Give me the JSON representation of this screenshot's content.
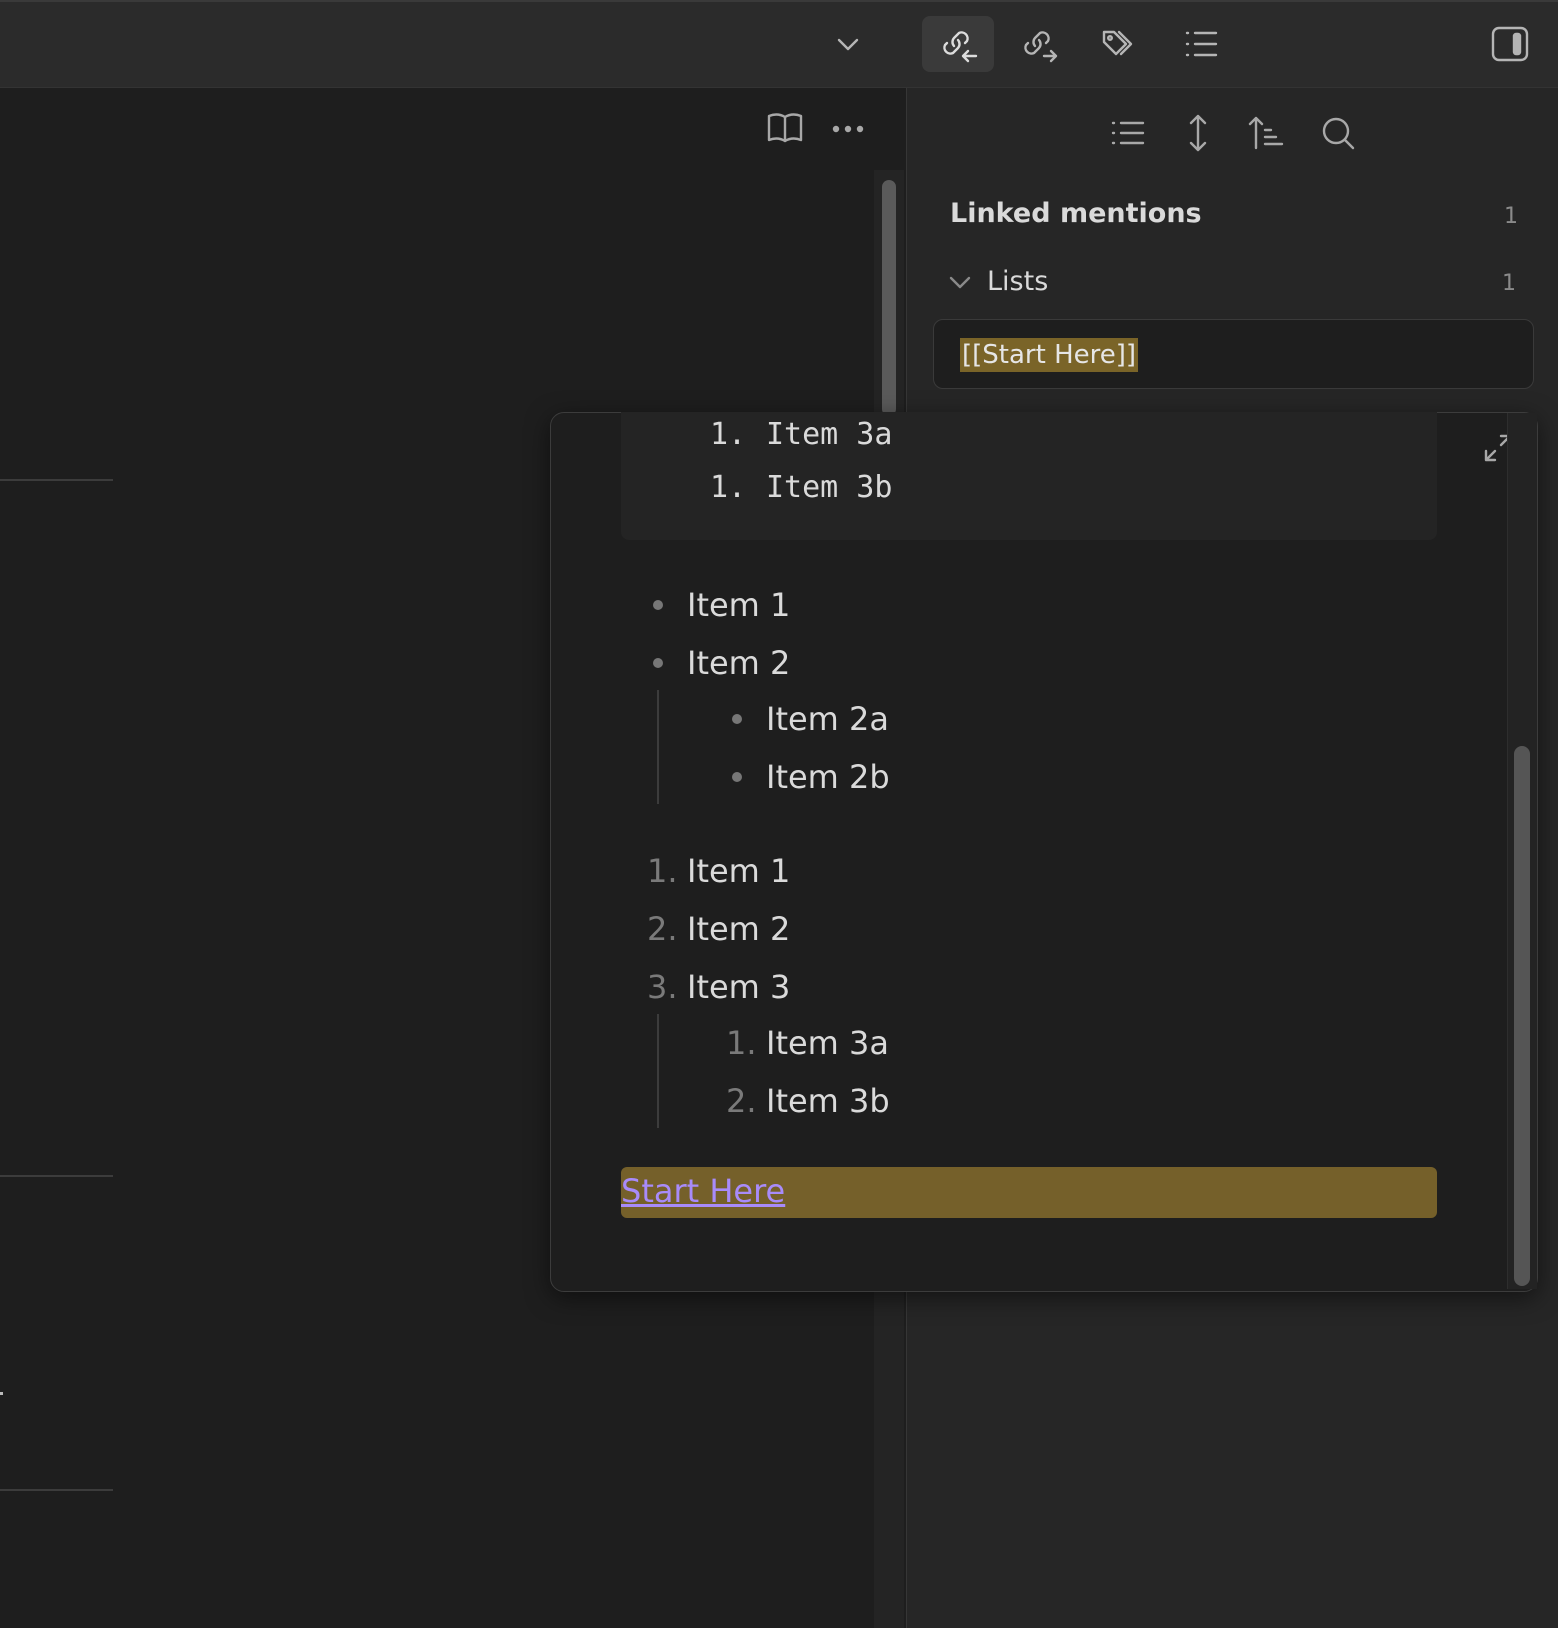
{
  "toolbar": {
    "icons": [
      "chevron-down-icon",
      "backlinks-icon",
      "outgoing-links-icon",
      "tags-icon",
      "outline-icon",
      "sidebar-toggle-icon"
    ]
  },
  "editor": {
    "header_icons": [
      "book-open-icon",
      "more-options-icon"
    ]
  },
  "sidebar": {
    "header_icons": [
      "list-icon",
      "expand-collapse-icon",
      "sort-icon",
      "search-icon"
    ],
    "section_title": "Linked mentions",
    "section_count": "1",
    "group_name": "Lists",
    "group_count": "1",
    "mention_text": "[[Start Here]]"
  },
  "popover": {
    "code_lines": [
      {
        "num": "1.",
        "text": "Item 3a"
      },
      {
        "num": "1.",
        "text": "Item 3b"
      }
    ],
    "bullet_list": [
      {
        "text": "Item 1"
      },
      {
        "text": "Item 2"
      },
      {
        "text": "Item 2a"
      },
      {
        "text": "Item 2b"
      }
    ],
    "ordered_list": [
      {
        "num": "1.",
        "text": "Item 1"
      },
      {
        "num": "2.",
        "text": "Item 2"
      },
      {
        "num": "3.",
        "text": "Item 3"
      },
      {
        "num": "1.",
        "text": "Item 3a"
      },
      {
        "num": "2.",
        "text": "Item 3b"
      }
    ],
    "link_text": "Start Here"
  },
  "colors": {
    "background": "#1e1e1e",
    "sidebar": "#262626",
    "highlight": "#75602a",
    "link": "#a88bfa"
  }
}
